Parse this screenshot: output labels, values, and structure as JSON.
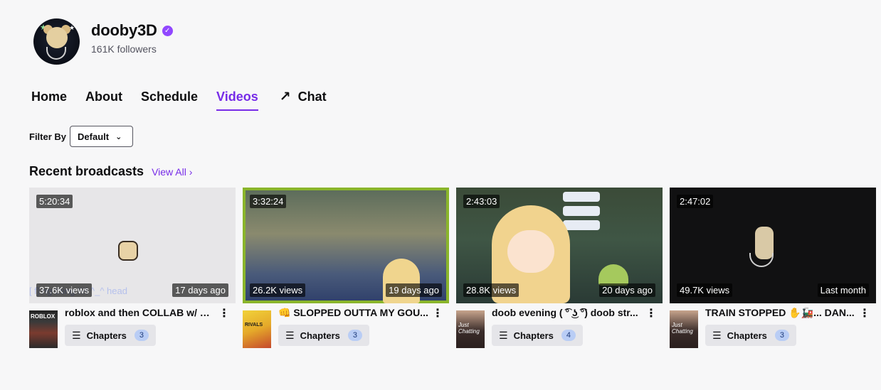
{
  "channel": {
    "name": "dooby3D",
    "verified_icon": "verified-checkmark-icon",
    "followers": "161K followers"
  },
  "nav": {
    "items": [
      {
        "label": "Home"
      },
      {
        "label": "About"
      },
      {
        "label": "Schedule"
      },
      {
        "label": "Videos",
        "active": true
      },
      {
        "label": "Chat",
        "icon": "external-arrow-icon"
      }
    ],
    "accent_color": "#772ce8"
  },
  "filter": {
    "label": "Filter By",
    "value": "Default"
  },
  "section": {
    "title": "Recent broadcasts",
    "view_all": "View All"
  },
  "videos": [
    {
      "duration": "5:20:34",
      "views": "37.6K views",
      "date": "17 days ago",
      "title": "roblox and then COLLAB w/ @...",
      "game_art": "ROBLOX",
      "chapters_label": "Chapters",
      "chapters_count": "3",
      "overlay_text": "[ f] ng thing !!!! ^_^ head"
    },
    {
      "duration": "3:32:24",
      "views": "26.2K views",
      "date": "19 days ago",
      "title": "👊 SLOPPED OUTTA MY GOU...",
      "game_art": "RIVALS",
      "chapters_label": "Chapters",
      "chapters_count": "3"
    },
    {
      "duration": "2:43:03",
      "views": "28.8K views",
      "date": "20 days ago",
      "title": "doob evening ( ͡° ͜ʖ ͡°) doob str...",
      "game_art": "Just Chatting",
      "chapters_label": "Chapters",
      "chapters_count": "4"
    },
    {
      "duration": "2:47:02",
      "views": "49.7K views",
      "date": "Last month",
      "title": "TRAIN STOPPED ✋🚂... DAN...",
      "game_art": "Just Chatting",
      "chapters_label": "Chapters",
      "chapters_count": "3"
    }
  ]
}
